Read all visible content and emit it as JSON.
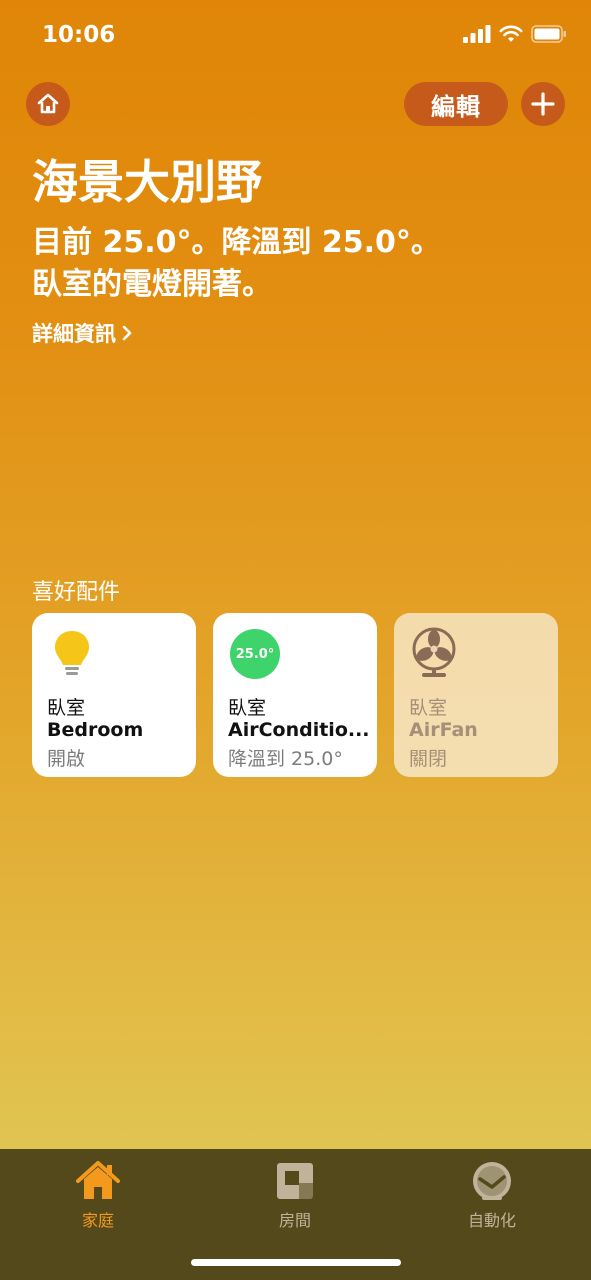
{
  "status_bar": {
    "time": "10:06",
    "icons": [
      "signal-icon",
      "wifi-icon",
      "battery-icon"
    ]
  },
  "header": {
    "home_icon": "house-icon",
    "edit_label": "編輯",
    "add_icon": "plus-icon"
  },
  "home": {
    "title": "海景大別野",
    "summary_line1": "目前 25.0°。降溫到 25.0°。",
    "summary_line2": "臥室的電燈開著。",
    "details_link": "詳細資訊"
  },
  "favorites": {
    "section_title": "喜好配件",
    "tiles": [
      {
        "icon": "lightbulb-icon",
        "room": "臥室",
        "name": "Bedroom",
        "state": "開啟",
        "on": true
      },
      {
        "icon": "thermostat-badge",
        "badge": "25.0°",
        "room": "臥室",
        "name": "AirConditio...",
        "state": "降溫到 25.0°",
        "on": true
      },
      {
        "icon": "fan-icon",
        "room": "臥室",
        "name": "AirFan",
        "state": "關閉",
        "on": false
      }
    ]
  },
  "tab_bar": {
    "tabs": [
      {
        "label": "家庭",
        "icon": "house-tab-icon",
        "selected": true
      },
      {
        "label": "房間",
        "icon": "rooms-icon",
        "selected": false
      },
      {
        "label": "自動化",
        "icon": "automation-clock-icon",
        "selected": false
      }
    ]
  },
  "colors": {
    "accent": "#F39A1E",
    "button_bg": "#C65A1A",
    "ac_badge": "#3FD36B",
    "tab_bar_bg": "#54491A"
  }
}
